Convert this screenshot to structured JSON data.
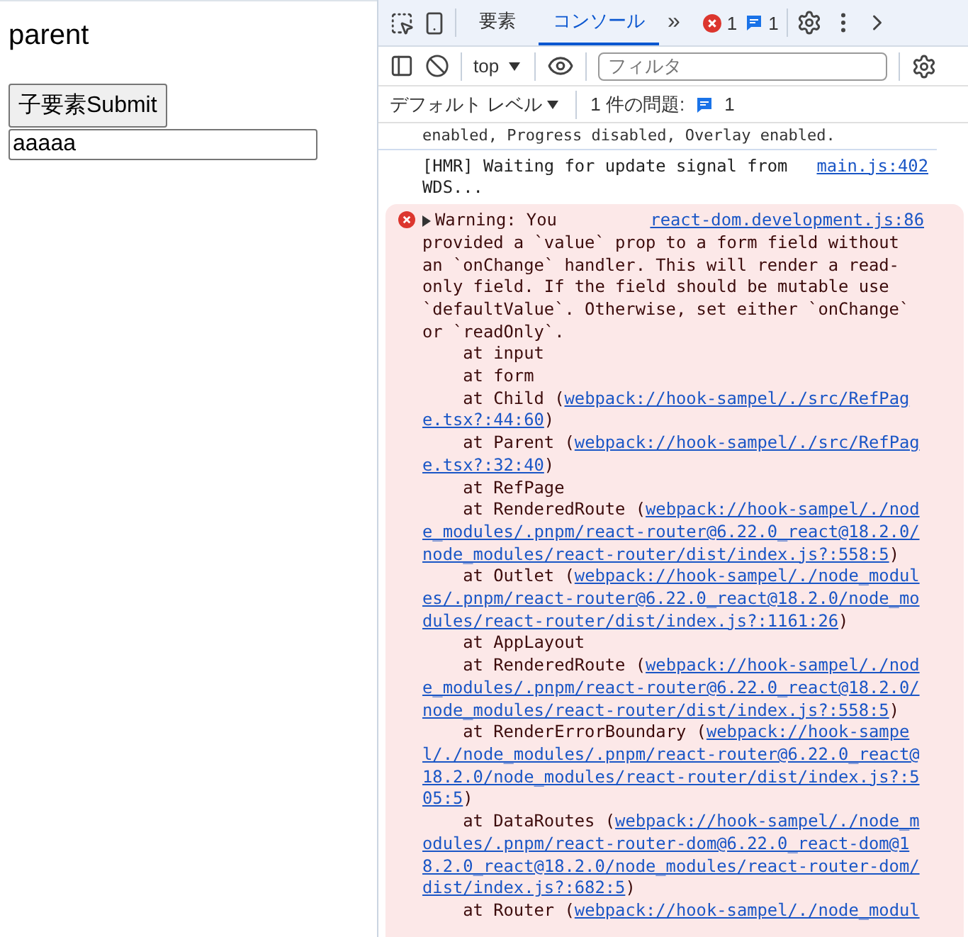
{
  "page": {
    "heading": "parent",
    "button": "子要素Submit",
    "input_value": "aaaaa"
  },
  "devtools": {
    "tabs": [
      {
        "label": "要素",
        "selected": false
      },
      {
        "label": "コンソール",
        "selected": true
      }
    ],
    "more_tabs": "»",
    "error_count": "1",
    "message_count": "1",
    "toolbar": {
      "context": "top",
      "filter_placeholder": "フィルタ"
    },
    "levels": {
      "label": "デフォルト レベル",
      "issues_label": "1 件の問題:",
      "issues_count": "1"
    },
    "console": {
      "partial_line": "enabled, Progress disabled, Overlay enabled.",
      "log": {
        "text": "[HMR] Waiting for update signal from WDS...",
        "source": "main.js:402"
      },
      "error": {
        "first": "Warning: You",
        "source": "react-dom.development.js:86",
        "body": "provided a `value` prop to a form field without an `onChange` handler. This will render a read-only field. If the field should be mutable use `defaultValue`. Otherwise, set either `onChange` or `readOnly`.",
        "frames": [
          {
            "at": "at input"
          },
          {
            "at": "at form"
          },
          {
            "at": "at Child",
            "open": "(",
            "link": "webpack://hook-sampel/./src/RefPage.tsx?:44:60",
            "close": ")"
          },
          {
            "at": "at Parent",
            "open": "(",
            "link": "webpack://hook-sampel/./src/RefPage.tsx?:32:40",
            "close": ")"
          },
          {
            "at": "at RefPage"
          },
          {
            "at": "at RenderedRoute",
            "open": "(",
            "link": "webpack://hook-sampel/./node_modules/.pnpm/react-router@6.22.0_react@18.2.0/node_modules/react-router/dist/index.js?:558:5",
            "close": ")"
          },
          {
            "at": "at Outlet",
            "open": "(",
            "link": "webpack://hook-sampel/./node_modules/.pnpm/react-router@6.22.0_react@18.2.0/node_modules/react-router/dist/index.js?:1161:26",
            "close": ")"
          },
          {
            "at": "at AppLayout"
          },
          {
            "at": "at RenderedRoute",
            "open": "(",
            "link": "webpack://hook-sampel/./node_modules/.pnpm/react-router@6.22.0_react@18.2.0/node_modules/react-router/dist/index.js?:558:5",
            "close": ")"
          },
          {
            "at": "at RenderErrorBoundary",
            "open": "(",
            "link": "webpack://hook-sampel/./node_modules/.pnpm/react-router@6.22.0_react@18.2.0/node_modules/react-router/dist/index.js?:505:5",
            "close": ")"
          },
          {
            "at": "at DataRoutes",
            "open": "(",
            "link": "webpack://hook-sampel/./node_modules/.pnpm/react-router-dom@6.22.0_react-dom@18.2.0_react@18.2.0/node_modules/react-router-dom/dist/index.js?:682:5",
            "close": ")"
          },
          {
            "at": "at Router",
            "open": "(",
            "link": "webpack://hook-sampel/./node_modul"
          }
        ]
      }
    }
  }
}
